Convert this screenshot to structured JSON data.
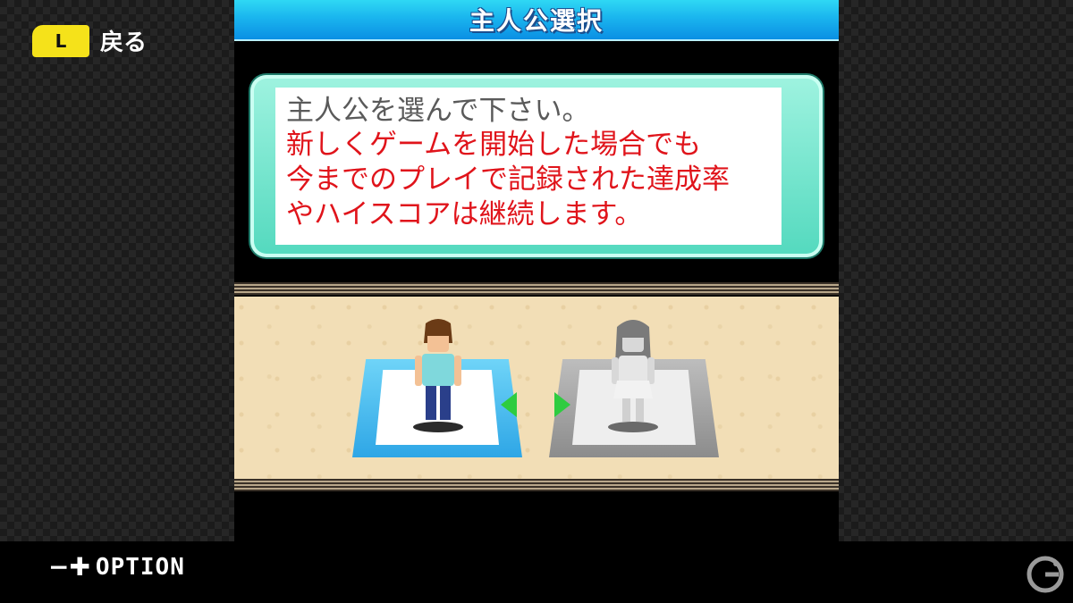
{
  "system_ui": {
    "back_key": "L",
    "back_label": "戻る",
    "option_icon": "−✚",
    "option_label": "OPTION"
  },
  "game": {
    "title": "主人公選択",
    "message": {
      "line1": "主人公を選んで下さい。",
      "line2": "新しくゲームを開始した場合でも",
      "line3": "今までのプレイで記録された達成率",
      "line4": "やハイスコアは継続します。"
    },
    "characters": [
      {
        "id": "hero",
        "selected": true,
        "icon": "boy-character-sprite"
      },
      {
        "id": "heroine",
        "selected": false,
        "icon": "girl-character-sprite"
      }
    ],
    "colors": {
      "accent_blue": "#1ab5ee",
      "msg_red": "#e0141b",
      "select_arrow": "#2ecc40"
    }
  }
}
